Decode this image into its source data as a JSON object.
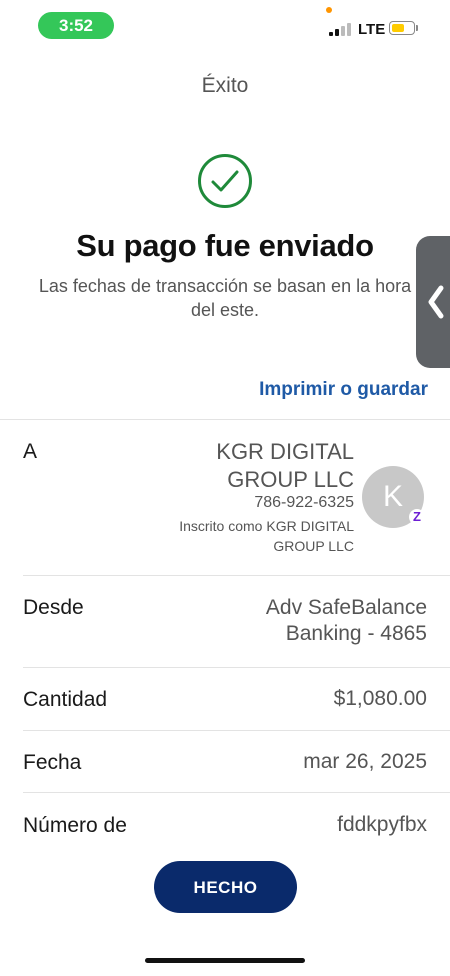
{
  "status_bar": {
    "time": "3:52",
    "network": "LTE",
    "battery_level": 0.65,
    "battery_color": "#ffcc00",
    "time_pill_color": "#34c759"
  },
  "header": {
    "title": "Éxito"
  },
  "confirmation": {
    "icon": "check-circle-icon",
    "title": "Su pago fue enviado",
    "subtitle": "Las fechas de transacción se basan en la hora del este.",
    "print_link": "Imprimir o guardar"
  },
  "details": {
    "to": {
      "label": "A",
      "name": "KGR DIGITAL GROUP LLC",
      "phone": "786-922-6325",
      "enrolled": "Inscrito como KGR DIGITAL GROUP LLC",
      "avatar_initial": "K",
      "badge_icon": "zelle-icon"
    },
    "from": {
      "label": "Desde",
      "value": "Adv SafeBalance Banking - 4865"
    },
    "amount": {
      "label": "Cantidad",
      "value": "$1,080.00"
    },
    "date": {
      "label": "Fecha",
      "value": "mar 26, 2025"
    },
    "number": {
      "label": "Número de",
      "value": "fddkpyfbx"
    }
  },
  "actions": {
    "done_label": "HECHO"
  },
  "colors": {
    "success_green": "#1f8a3a",
    "link_blue": "#1f5aa6",
    "button_navy": "#0a2a6b",
    "zelle_purple": "#6d1ed4"
  }
}
